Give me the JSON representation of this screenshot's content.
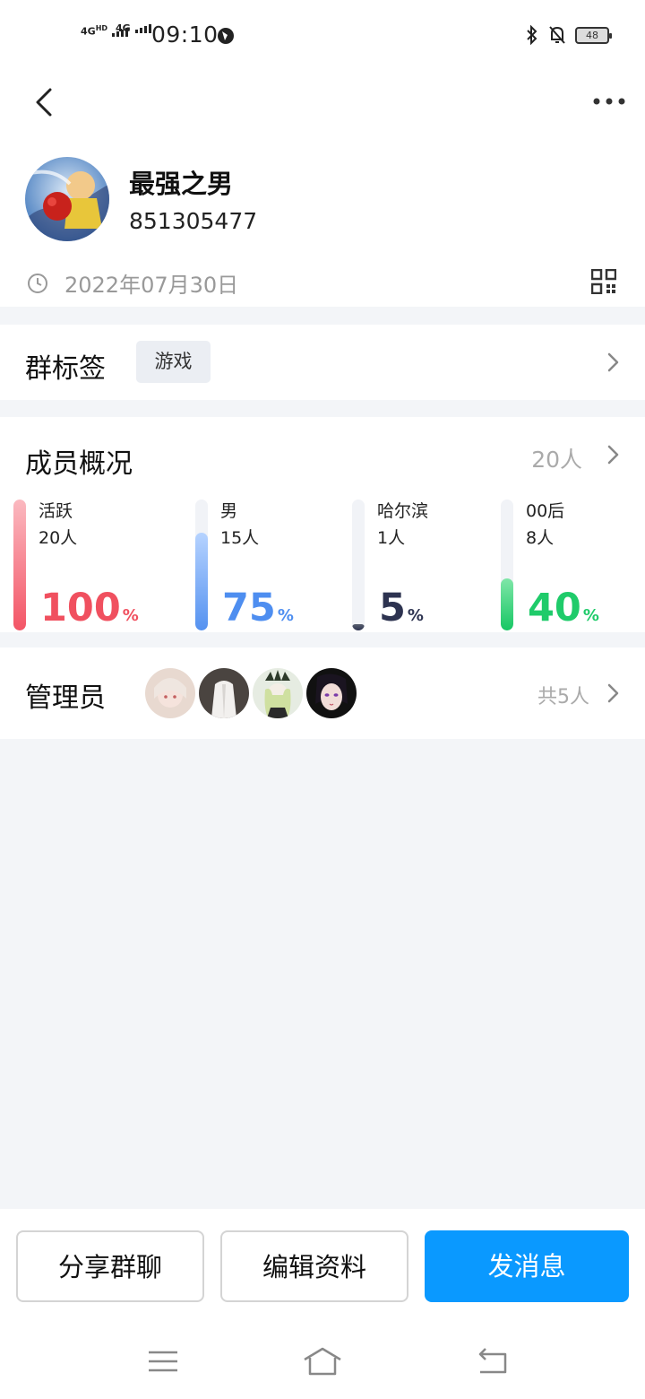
{
  "status_bar": {
    "sim1": "4G",
    "sim1_tag": "HD",
    "sim2": "4G",
    "time": "09:10",
    "battery": "48"
  },
  "group": {
    "name": "最强之男",
    "id": "851305477",
    "created_date": "2022年07月30日"
  },
  "tags": {
    "title": "群标签",
    "items": [
      "游戏"
    ]
  },
  "members": {
    "title": "成员概况",
    "total": "20人",
    "stats": [
      {
        "label": "活跃",
        "count": "20人",
        "percent": "100",
        "unit": "%",
        "fraction": 1.0,
        "color": "#f0505f",
        "fill_top": "#fbb9c0",
        "fill_bottom": "#f35566"
      },
      {
        "label": "男",
        "count": "15人",
        "percent": "75",
        "unit": "%",
        "fraction": 0.75,
        "color": "#4e8ef0",
        "fill_top": "#b6d3ff",
        "fill_bottom": "#5592f0"
      },
      {
        "label": "哈尔滨",
        "count": "1人",
        "percent": "5",
        "unit": "%",
        "fraction": 0.05,
        "color": "#2d3350",
        "fill_top": "#5a6070",
        "fill_bottom": "#2d3350"
      },
      {
        "label": "00后",
        "count": "8人",
        "percent": "40",
        "unit": "%",
        "fraction": 0.4,
        "color": "#1fcb6a",
        "fill_top": "#7fe6a8",
        "fill_bottom": "#17c764"
      }
    ]
  },
  "admins": {
    "title": "管理员",
    "total": "共5人",
    "avatars": [
      "admin-avatar-1",
      "admin-avatar-2",
      "admin-avatar-3",
      "admin-avatar-4"
    ]
  },
  "actions": {
    "share": "分享群聊",
    "edit": "编辑资料",
    "send": "发消息"
  },
  "colors": {
    "primary": "#0a99ff",
    "muted": "#999999",
    "page_bg": "#f3f5f8"
  },
  "icons": [
    "back-arrow-icon",
    "more-icon",
    "clock-icon",
    "qr-code-icon",
    "chevron-right-icon",
    "menu-icon",
    "home-icon",
    "back-nav-icon",
    "bluetooth-icon",
    "bell-off-icon"
  ]
}
